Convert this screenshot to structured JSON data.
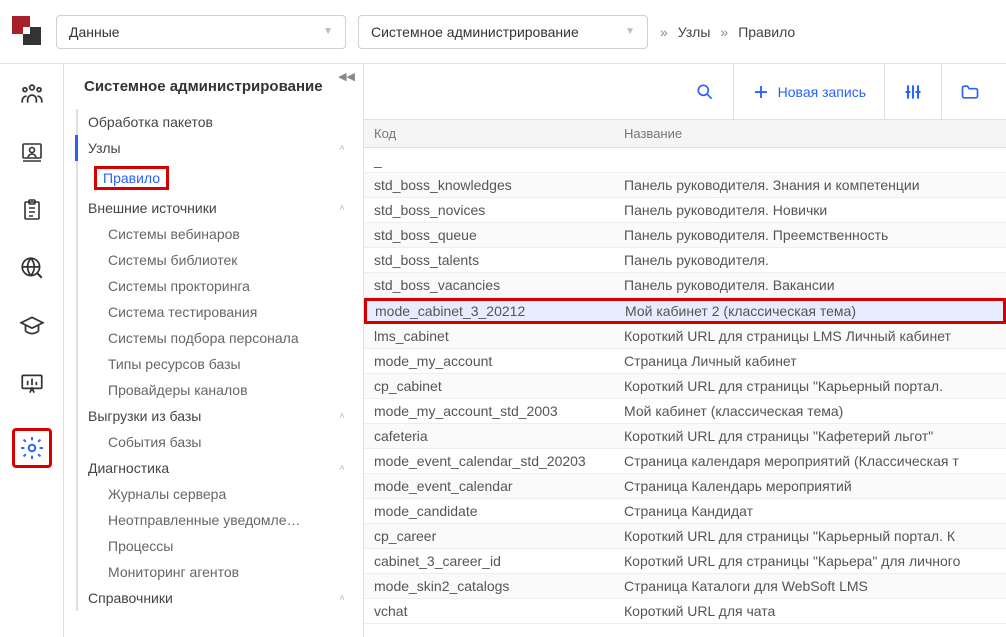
{
  "header": {
    "select1": "Данные",
    "select2": "Системное администрирование",
    "breadcrumb": [
      "Узлы",
      "Правило"
    ]
  },
  "sidebar": {
    "title": "Системное администрирование",
    "tree": [
      {
        "label": "Обработка пакетов",
        "level": 1,
        "expandable": false
      },
      {
        "label": "Узлы",
        "level": 1,
        "expandable": true,
        "active": true
      },
      {
        "label": "Правило",
        "level": 2,
        "boxed": true
      },
      {
        "label": "Внешние источники",
        "level": 1,
        "expandable": true
      },
      {
        "label": "Системы вебинаров",
        "level": 2
      },
      {
        "label": "Системы библиотек",
        "level": 2
      },
      {
        "label": "Системы прокторинга",
        "level": 2
      },
      {
        "label": "Система тестирования",
        "level": 2
      },
      {
        "label": "Системы подбора персонала",
        "level": 2
      },
      {
        "label": "Типы ресурсов базы",
        "level": 2
      },
      {
        "label": "Провайдеры каналов",
        "level": 2
      },
      {
        "label": "Выгрузки из базы",
        "level": 1,
        "expandable": true
      },
      {
        "label": "События базы",
        "level": 2
      },
      {
        "label": "Диагностика",
        "level": 1,
        "expandable": true
      },
      {
        "label": "Журналы сервера",
        "level": 2
      },
      {
        "label": "Неотправленные уведомле…",
        "level": 2
      },
      {
        "label": "Процессы",
        "level": 2
      },
      {
        "label": "Мониторинг агентов",
        "level": 2
      },
      {
        "label": "Справочники",
        "level": 1,
        "expandable": true
      }
    ]
  },
  "toolbar": {
    "new_label": "Новая запись"
  },
  "grid": {
    "columns": {
      "code": "Код",
      "name": "Название"
    },
    "rows": [
      {
        "code": "_",
        "name": " "
      },
      {
        "code": "std_boss_knowledges",
        "name": "Панель руководителя. Знания и компетенции"
      },
      {
        "code": "std_boss_novices",
        "name": "Панель руководителя. Новички"
      },
      {
        "code": "std_boss_queue",
        "name": "Панель руководителя. Преемственность"
      },
      {
        "code": "std_boss_talents",
        "name": "Панель руководителя."
      },
      {
        "code": "std_boss_vacancies",
        "name": "Панель руководителя. Вакансии"
      },
      {
        "code": "mode_cabinet_3_20212",
        "name": "Мой кабинет 2 (классическая тема)",
        "highlighted": true
      },
      {
        "code": "lms_cabinet",
        "name": "Короткий URL для страницы LMS Личный кабинет"
      },
      {
        "code": "mode_my_account",
        "name": "Страница Личный кабинет"
      },
      {
        "code": "cp_cabinet",
        "name": "Короткий URL для страницы \"Карьерный портал."
      },
      {
        "code": "mode_my_account_std_2003",
        "name": "Мой кабинет (классическая тема)"
      },
      {
        "code": "cafeteria",
        "name": "Короткий URL для страницы \"Кафетерий льгот\""
      },
      {
        "code": "mode_event_calendar_std_20203",
        "name": "Страница календаря мероприятий (Классическая т"
      },
      {
        "code": "mode_event_calendar",
        "name": "Страница Календарь мероприятий"
      },
      {
        "code": "mode_candidate",
        "name": "Страница Кандидат"
      },
      {
        "code": "cp_career",
        "name": "Короткий URL для страницы \"Карьерный портал. К"
      },
      {
        "code": "cabinet_3_career_id",
        "name": "Короткий URL для страницы \"Карьера\" для личного"
      },
      {
        "code": "mode_skin2_catalogs",
        "name": "Страница Каталоги для WebSoft LMS"
      },
      {
        "code": "vchat",
        "name": "Короткий URL для чата"
      }
    ]
  }
}
